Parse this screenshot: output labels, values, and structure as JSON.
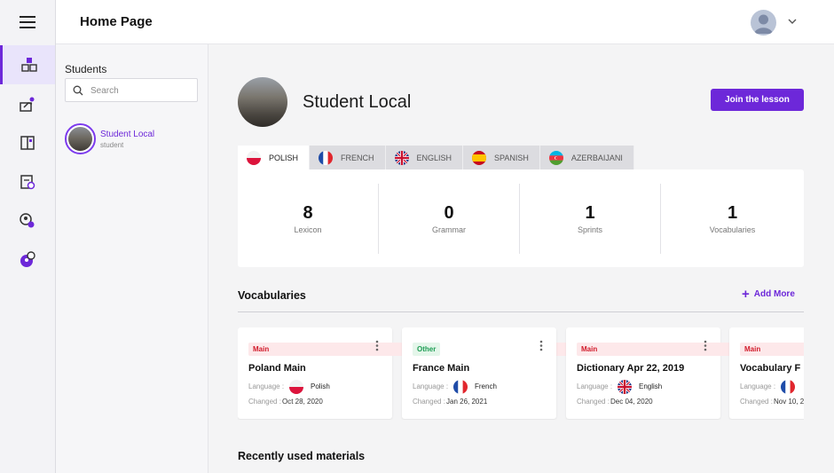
{
  "header": {
    "title": "Home Page"
  },
  "colors": {
    "accent": "#6d28d9",
    "main_badge": "#d11a2a",
    "other_badge": "#1f9d55"
  },
  "sidebar": {
    "icons": [
      "menu-icon",
      "dashboard-icon",
      "teaching-icon",
      "books-icon",
      "calendar-document-icon",
      "user-settings-icon",
      "user-question-icon"
    ]
  },
  "students": {
    "heading": "Students",
    "search_placeholder": "Search",
    "items": [
      {
        "name": "Student Local",
        "role": "student"
      }
    ]
  },
  "profile": {
    "name": "Student Local",
    "join_label": "Join the lesson"
  },
  "tabs": [
    {
      "label": "POLISH",
      "flag": "poland"
    },
    {
      "label": "FRENCH",
      "flag": "france"
    },
    {
      "label": "ENGLISH",
      "flag": "uk"
    },
    {
      "label": "SPANISH",
      "flag": "spain"
    },
    {
      "label": "AZERBAIJANI",
      "flag": "azerbaijan"
    }
  ],
  "stats": [
    {
      "value": "8",
      "label": "Lexicon"
    },
    {
      "value": "0",
      "label": "Grammar"
    },
    {
      "value": "1",
      "label": "Sprints"
    },
    {
      "value": "1",
      "label": "Vocabularies"
    }
  ],
  "vocabularies": {
    "title": "Vocabularies",
    "add_more": "Add More",
    "language_label": "Language :",
    "changed_label": "Changed :",
    "cards": [
      {
        "badge": "Main",
        "title": "Poland Main",
        "language": "Polish",
        "changed": "Oct 28, 2020"
      },
      {
        "badge": "Other",
        "title": "France Main",
        "language": "French",
        "changed": "Jan 26, 2021"
      },
      {
        "badge": "Main",
        "title": "Dictionary Apr 22, 2019",
        "language": "English",
        "changed": "Dec 04, 2020"
      },
      {
        "badge": "Main",
        "title": "Vocabulary F",
        "language": "",
        "changed": "Nov 10, 2"
      }
    ]
  },
  "recent": {
    "title": "Recently used materials"
  }
}
